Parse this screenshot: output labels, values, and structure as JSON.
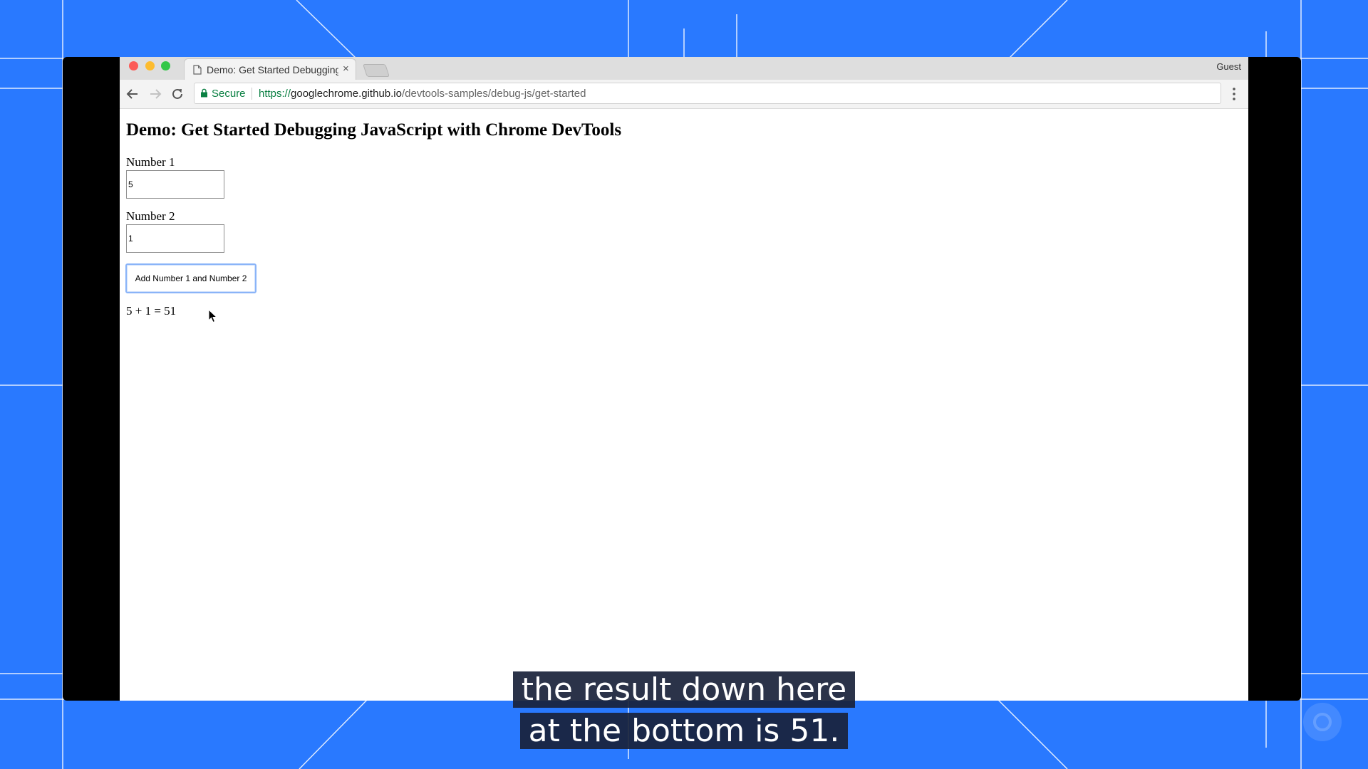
{
  "browser": {
    "tab_title": "Demo: Get Started Debugging JavaScript with Chrome DevTools",
    "tab_close": "×",
    "profile": "Guest",
    "secure_label": "Secure",
    "url_scheme": "https://",
    "url_host": "googlechrome.github.io",
    "url_path": "/devtools-samples/debug-js/get-started"
  },
  "page": {
    "title": "Demo: Get Started Debugging JavaScript with Chrome DevTools",
    "number1_label": "Number 1",
    "number1_value": "5",
    "number2_label": "Number 2",
    "number2_value": "1",
    "button_label": "Add Number 1 and Number 2",
    "result": "5 + 1 = 51"
  },
  "caption": {
    "line1": "the result down here",
    "line2": "at the bottom is 51."
  },
  "colors": {
    "background": "#2979ff",
    "secure_green": "#0b8043",
    "button_focus": "#8ab4f8"
  }
}
